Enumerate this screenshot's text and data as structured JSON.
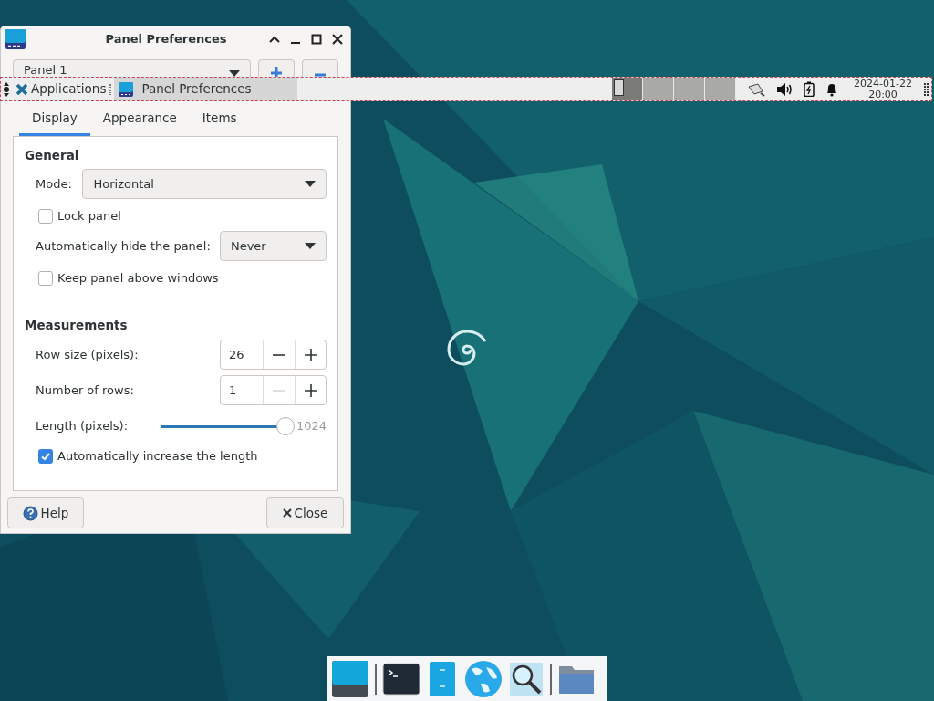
{
  "dialog": {
    "title": "Panel Preferences",
    "panel_select": {
      "value": "Panel 1"
    },
    "tabs": [
      {
        "label": "Display",
        "selected": true
      },
      {
        "label": "Appearance",
        "selected": false
      },
      {
        "label": "Items",
        "selected": false
      }
    ],
    "general": {
      "heading": "General",
      "mode": {
        "label": "Mode:",
        "value": "Horizontal"
      },
      "lock_panel": {
        "label": "Lock panel",
        "checked": false
      },
      "autohide": {
        "label": "Automatically hide the panel:",
        "value": "Never"
      },
      "keep_above": {
        "label": "Keep panel above windows",
        "checked": false
      }
    },
    "measurements": {
      "heading": "Measurements",
      "spinners": [
        {
          "label": "Row size (pixels):",
          "value": "26",
          "decrement_disabled": false
        },
        {
          "label": "Number of rows:",
          "value": "1",
          "decrement_disabled": true
        }
      ],
      "length": {
        "label": "Length (pixels):",
        "level": 1,
        "reading": "1024"
      },
      "auto_increase": {
        "label": "Automatically increase the length",
        "checked": true
      }
    },
    "buttons": [
      {
        "kind": "help",
        "label": "Help"
      },
      {
        "kind": "close",
        "label": "Close"
      }
    ]
  },
  "top_panel": {
    "applications": "Applications",
    "tasks": [
      {
        "title": "Panel Preferences",
        "selected": true
      }
    ],
    "workspaces": [
      {
        "selected": true
      },
      {
        "selected": false
      },
      {
        "selected": false
      },
      {
        "selected": false
      }
    ],
    "clock": {
      "date": "2024-01-22",
      "time": "20:00"
    }
  }
}
